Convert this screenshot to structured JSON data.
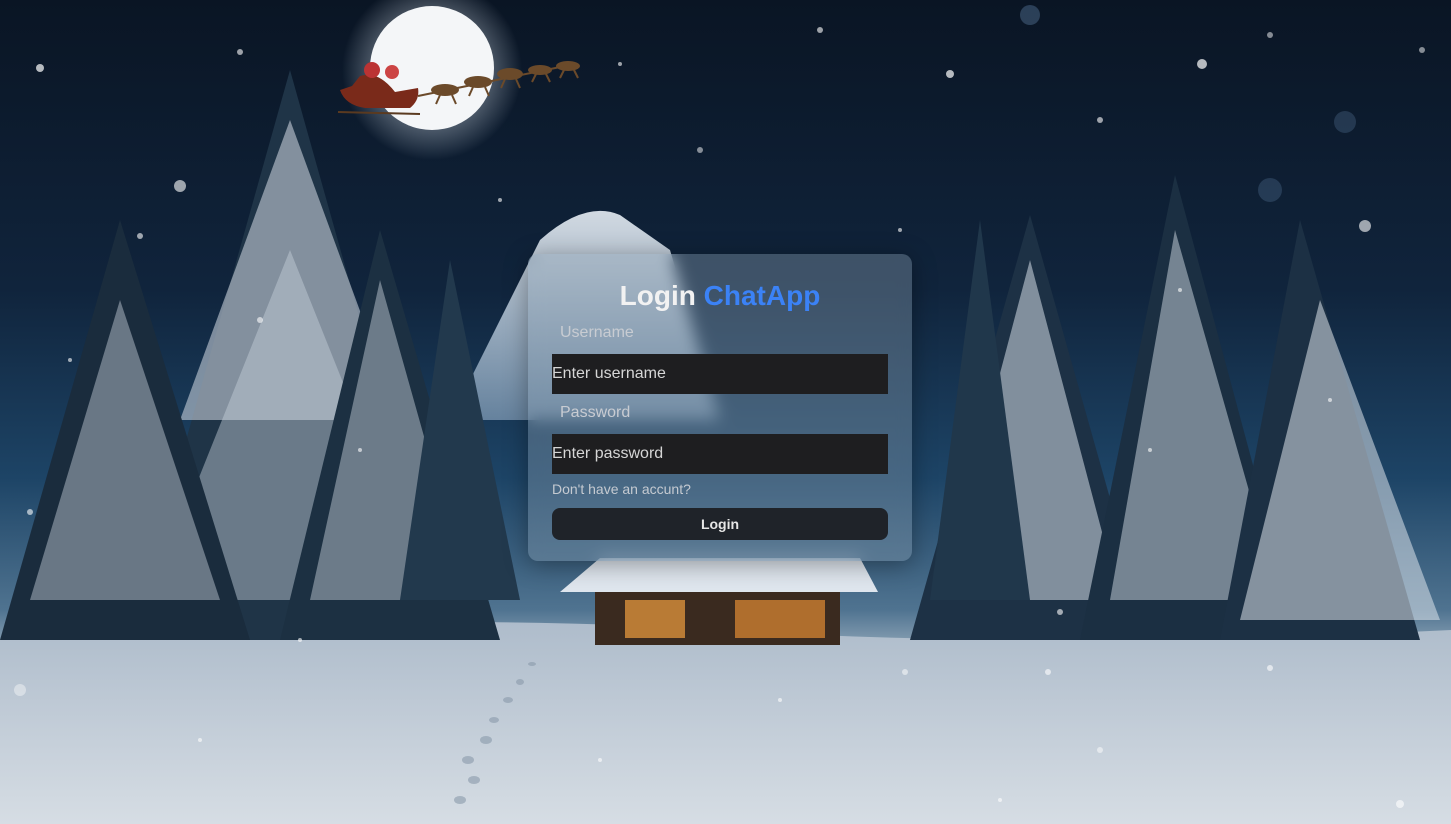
{
  "title": {
    "prefix": "Login",
    "brand": "ChatApp"
  },
  "form": {
    "username_label": "Username",
    "username_placeholder": "Enter username",
    "password_label": "Password",
    "password_placeholder": "Enter password",
    "signup_link": "Don't have an accunt?",
    "submit_label": "Login"
  },
  "colors": {
    "brand": "#3b82f6",
    "input_bg": "#1e1e20",
    "button_bg": "#1f2329"
  }
}
